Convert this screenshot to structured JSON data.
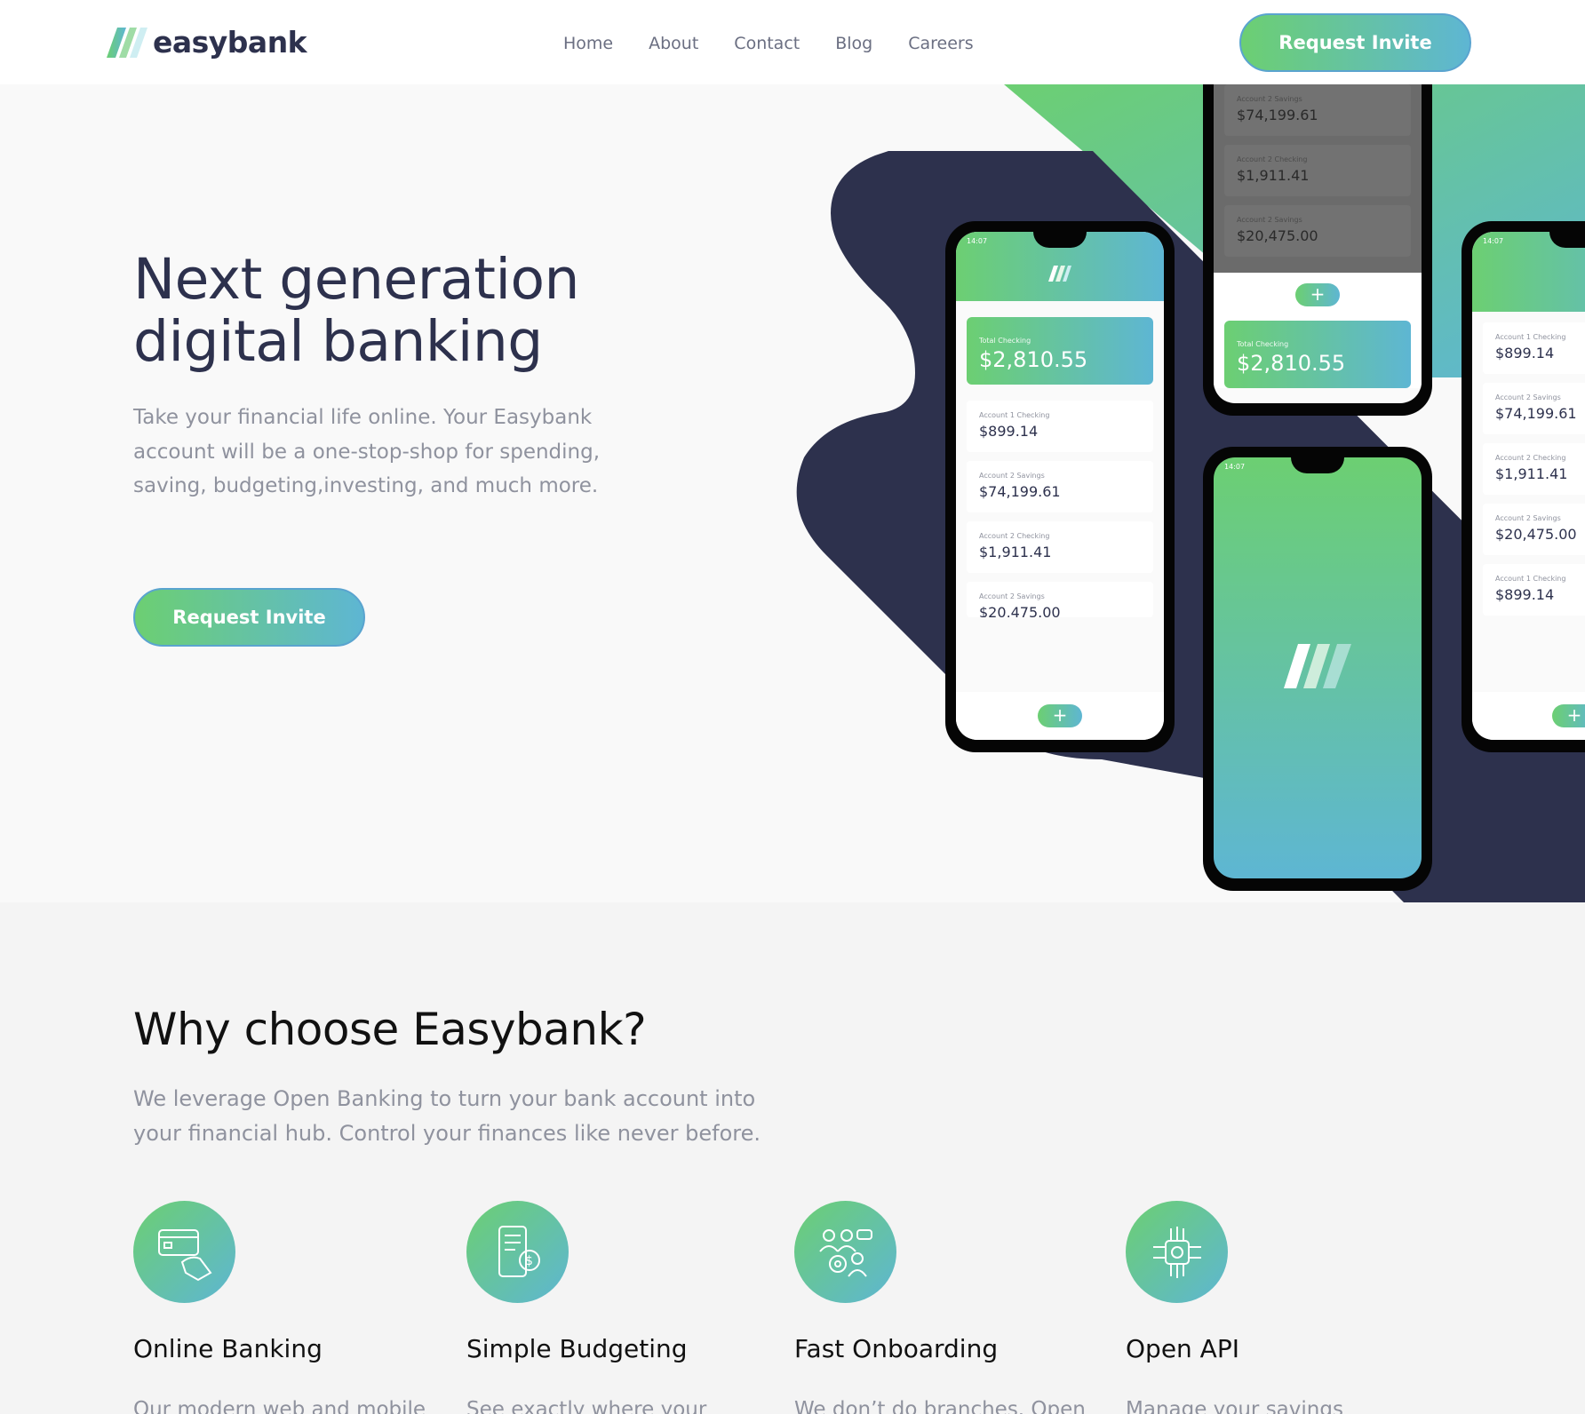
{
  "brand": {
    "name": "easybank"
  },
  "nav": {
    "links": [
      "Home",
      "About",
      "Contact",
      "Blog",
      "Careers"
    ],
    "cta_label": "Request Invite"
  },
  "hero": {
    "title_line1": "Next generation",
    "title_line2": "digital banking",
    "subtitle": "Take your financial life online. Your Easybank account will be a one-stop-shop for spending, saving, budgeting,investing, and much more.",
    "cta_label": "Request Invite",
    "phones": {
      "status_time": "14:07",
      "total_label": "Total Checking",
      "total_amount": "$2,810.55",
      "plus_symbol": "+",
      "left_rows": [
        {
          "label": "Account 1 Checking",
          "amount": "$899.14"
        },
        {
          "label": "Account 2 Savings",
          "amount": "$74,199.61"
        },
        {
          "label": "Account 2 Checking",
          "amount": "$1,911.41"
        },
        {
          "label": "Account 2 Savings",
          "amount": "$20,475.00"
        }
      ],
      "top_rows": [
        {
          "label": "Account 2 Savings",
          "amount": "$74,199.61"
        },
        {
          "label": "Account 2 Checking",
          "amount": "$1,911.41"
        },
        {
          "label": "Account 2 Savings",
          "amount": "$20,475.00"
        }
      ],
      "right_rows": [
        {
          "label": "Account 1 Checking",
          "amount": "$899.14"
        },
        {
          "label": "Account 2 Savings",
          "amount": "$74,199.61"
        },
        {
          "label": "Account 2 Checking",
          "amount": "$1,911.41"
        },
        {
          "label": "Account 2 Savings",
          "amount": "$20,475.00"
        },
        {
          "label": "Account 1 Checking",
          "amount": "$899.14"
        }
      ]
    }
  },
  "why": {
    "title": "Why choose Easybank?",
    "subtitle": "We leverage Open Banking to turn your bank account into your financial hub. Control your finances like never before.",
    "features": [
      {
        "title": "Online Banking",
        "desc": "Our modern web and mobile",
        "icon": "card-hand-icon"
      },
      {
        "title": "Simple Budgeting",
        "desc": "See exactly where your",
        "icon": "phone-budget-icon"
      },
      {
        "title": "Fast Onboarding",
        "desc": "We don’t do branches. Open",
        "icon": "team-onboarding-icon"
      },
      {
        "title": "Open API",
        "desc": "Manage your savings",
        "icon": "chip-api-icon"
      }
    ]
  },
  "colors": {
    "navy": "#2d314d",
    "green": "#6ccf72",
    "blue": "#5eb6d3",
    "grey_text": "#8f929e",
    "bg": "#f4f4f4"
  }
}
